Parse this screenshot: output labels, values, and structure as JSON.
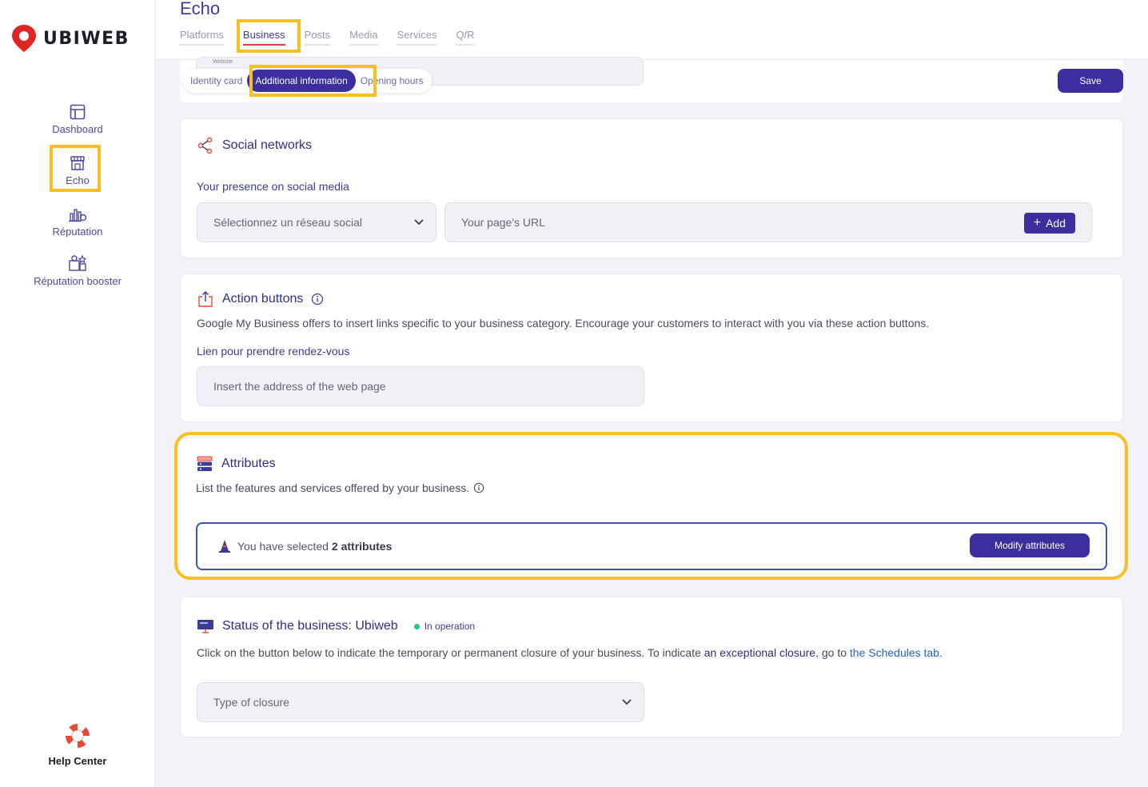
{
  "brand": {
    "name": "UBIWEB"
  },
  "sidebar": {
    "items": [
      {
        "label": "Dashboard",
        "icon": "dashboard-icon"
      },
      {
        "label": "Echo",
        "icon": "storefront-icon",
        "active": true
      },
      {
        "label": "Réputation",
        "icon": "reputation-icon"
      },
      {
        "label": "Réputation booster",
        "icon": "booster-icon"
      }
    ],
    "help": {
      "label": "Help Center",
      "icon": "lifebuoy-icon"
    }
  },
  "header": {
    "title": "Echo",
    "tabs": [
      {
        "label": "Platforms"
      },
      {
        "label": "Business",
        "active": true
      },
      {
        "label": "Posts"
      },
      {
        "label": "Media"
      },
      {
        "label": "Services"
      },
      {
        "label": "Q/R"
      }
    ]
  },
  "subtabs": {
    "items": [
      {
        "label": "Identity card"
      },
      {
        "label": "Additional information",
        "active": true
      },
      {
        "label": "Opening hours"
      }
    ],
    "save_label": "Save",
    "ghost_label": "Website"
  },
  "social": {
    "title": "Social networks",
    "subtitle": "Your presence on social media",
    "select_placeholder": "Sélectionnez un réseau social",
    "url_placeholder": "Your page's URL",
    "add_label": "Add"
  },
  "actions": {
    "title": "Action buttons",
    "description": "Google My Business offers to insert links specific to your business category. Encourage your customers to interact with you via these action buttons.",
    "field_label": "Lien pour prendre rendez-vous",
    "field_placeholder": "Insert the address of the web page"
  },
  "attributes": {
    "title": "Attributes",
    "description": "List the features and services offered by your business.",
    "selected_prefix": "You have selected",
    "selected_count": "2 attributes",
    "modify_label": "Modify attributes"
  },
  "status": {
    "title": "Status of the business: Ubiweb",
    "badge": "In operation",
    "desc_part1": "Click on the button below to indicate the temporary or permanent closure of your business. To indicate ",
    "link1": "an exceptional closure",
    "desc_part2": ", go to ",
    "link2": "the Schedules tab.",
    "closure_placeholder": "Type of closure"
  },
  "colors": {
    "primary": "#3b2fa0",
    "highlight": "#f7bf22",
    "accent_red": "#e23b3b",
    "status_green": "#2bbf8a"
  }
}
